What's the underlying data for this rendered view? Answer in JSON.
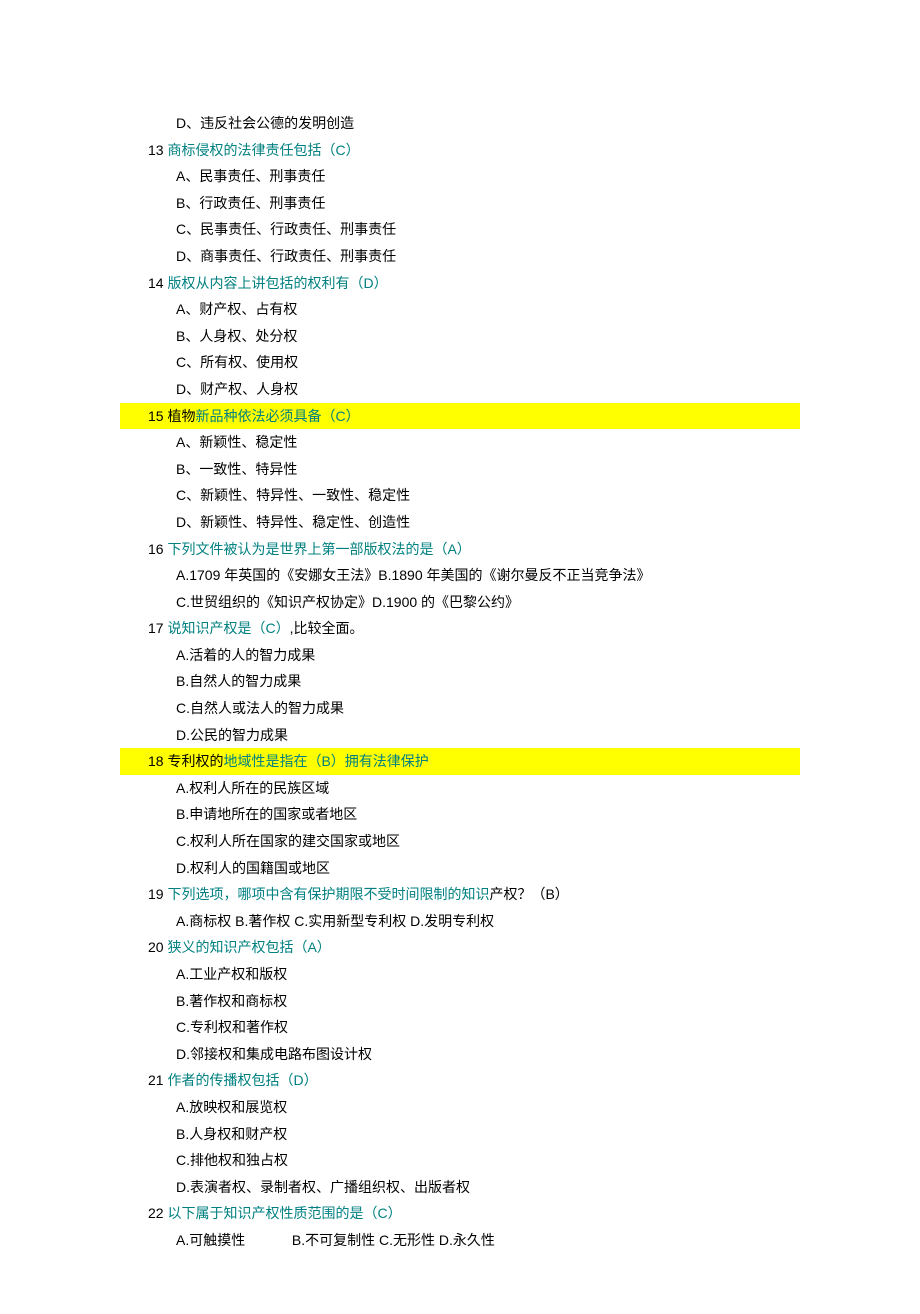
{
  "lines": [
    {
      "cls": "indent2",
      "segs": [
        {
          "t": "D、违反社会公德的发明创造"
        }
      ]
    },
    {
      "cls": "indent1",
      "segs": [
        {
          "t": "13 "
        },
        {
          "t": "商标侵权的法律责任包括（C）",
          "c": "teal"
        }
      ]
    },
    {
      "cls": "indent2",
      "segs": [
        {
          "t": "A、民事责任、刑事责任"
        }
      ]
    },
    {
      "cls": "indent2",
      "segs": [
        {
          "t": "B、行政责任、刑事责任"
        }
      ]
    },
    {
      "cls": "indent2",
      "segs": [
        {
          "t": "C、民事责任、行政责任、刑事责任"
        }
      ]
    },
    {
      "cls": "indent2",
      "segs": [
        {
          "t": "D、商事责任、行政责任、刑事责任"
        }
      ]
    },
    {
      "cls": "indent1",
      "segs": [
        {
          "t": "14 "
        },
        {
          "t": "版权从内容上讲包括的权利有（D）",
          "c": "teal"
        }
      ]
    },
    {
      "cls": "indent2",
      "segs": [
        {
          "t": "A、财产权、占有权"
        }
      ]
    },
    {
      "cls": "indent2",
      "segs": [
        {
          "t": "B、人身权、处分权"
        }
      ]
    },
    {
      "cls": "indent2",
      "segs": [
        {
          "t": "C、所有权、使用权"
        }
      ]
    },
    {
      "cls": "indent2",
      "segs": [
        {
          "t": "D、财产权、人身权"
        }
      ]
    },
    {
      "cls": "indent1 hl-line",
      "segs": [
        {
          "t": "15 植物"
        },
        {
          "t": "新品种依法必须具备（C）",
          "c": "teal"
        }
      ]
    },
    {
      "cls": "indent2",
      "segs": [
        {
          "t": "A、新颖性、稳定性"
        }
      ]
    },
    {
      "cls": "indent2",
      "segs": [
        {
          "t": "B、一致性、特异性"
        }
      ]
    },
    {
      "cls": "indent2",
      "segs": [
        {
          "t": "C、新颖性、特异性、一致性、稳定性"
        }
      ]
    },
    {
      "cls": "indent2",
      "segs": [
        {
          "t": "D、新颖性、特异性、稳定性、创造性"
        }
      ]
    },
    {
      "cls": "indent1",
      "segs": [
        {
          "t": "16 "
        },
        {
          "t": "下列文件被认为是世界上第一部版权法的是（A）",
          "c": "teal"
        }
      ]
    },
    {
      "cls": "indent2",
      "segs": [
        {
          "t": "A.1709 年英国的《安娜女王法》B.1890 年美国的《谢尔曼反不正当竞争法》"
        }
      ]
    },
    {
      "cls": "indent2",
      "segs": [
        {
          "t": "C.世贸组织的《知识产权协定》D.1900 的《巴黎公约》"
        }
      ]
    },
    {
      "cls": "indent1",
      "segs": [
        {
          "t": "17 "
        },
        {
          "t": "说知识产权是（C）",
          "c": "teal"
        },
        {
          "t": ",比较全面。"
        }
      ]
    },
    {
      "cls": "indent2",
      "segs": [
        {
          "t": "A.活着的人的智力成果"
        }
      ]
    },
    {
      "cls": "indent2",
      "segs": [
        {
          "t": "B.自然人的智力成果"
        }
      ]
    },
    {
      "cls": "indent2",
      "segs": [
        {
          "t": "C.自然人或法人的智力成果"
        }
      ]
    },
    {
      "cls": "indent2",
      "segs": [
        {
          "t": "D.公民的智力成果"
        }
      ]
    },
    {
      "cls": "indent1 hl-line",
      "segs": [
        {
          "t": "18 专利权的"
        },
        {
          "t": "地域性是指在（B）拥有法律保护",
          "c": "teal"
        }
      ]
    },
    {
      "cls": "indent2",
      "segs": [
        {
          "t": "A.权利人所在的民族区域"
        }
      ]
    },
    {
      "cls": "indent2",
      "segs": [
        {
          "t": "B.申请地所在的国家或者地区"
        }
      ]
    },
    {
      "cls": "indent2",
      "segs": [
        {
          "t": "C.权利人所在国家的建交国家或地区"
        }
      ]
    },
    {
      "cls": "indent2",
      "segs": [
        {
          "t": "D.权利人的国籍国或地区"
        }
      ]
    },
    {
      "cls": "indent1",
      "segs": [
        {
          "t": "19 "
        },
        {
          "t": "下列选项，哪项中含有保护期限不受时间限制的知识",
          "c": "teal"
        },
        {
          "t": "产权？（B）"
        }
      ]
    },
    {
      "cls": "indent2",
      "segs": [
        {
          "t": "A.商标权 B.著作权 C.实用新型专利权 D.发明专利权"
        }
      ]
    },
    {
      "cls": "indent1",
      "segs": [
        {
          "t": "20 "
        },
        {
          "t": "狭义的知识产权包括（A）",
          "c": "teal"
        }
      ]
    },
    {
      "cls": "indent2",
      "segs": [
        {
          "t": "A.工业产权和版权"
        }
      ]
    },
    {
      "cls": "indent2",
      "segs": [
        {
          "t": "B.著作权和商标权"
        }
      ]
    },
    {
      "cls": "indent2",
      "segs": [
        {
          "t": "C.专利权和著作权"
        }
      ]
    },
    {
      "cls": "indent2",
      "segs": [
        {
          "t": "D.邻接权和集成电路布图设计权"
        }
      ]
    },
    {
      "cls": "indent1",
      "segs": [
        {
          "t": "21 "
        },
        {
          "t": "作者的传播权包括（D）",
          "c": "teal"
        }
      ]
    },
    {
      "cls": "indent2",
      "segs": [
        {
          "t": "A.放映权和展览权"
        }
      ]
    },
    {
      "cls": "indent2",
      "segs": [
        {
          "t": "B.人身权和财产权"
        }
      ]
    },
    {
      "cls": "indent2",
      "segs": [
        {
          "t": "C.排他权和独占权"
        }
      ]
    },
    {
      "cls": "indent2",
      "segs": [
        {
          "t": "D.表演者权、录制者权、广播组织权、出版者权"
        }
      ]
    },
    {
      "cls": "indent1",
      "segs": [
        {
          "t": "22 "
        },
        {
          "t": "以下属于知识产权性质范围的是（C）",
          "c": "teal"
        }
      ]
    },
    {
      "cls": "indent2",
      "segs": [
        {
          "t": "A.可触摸性            B.不可复制性 C.无形性 D.永久性"
        }
      ]
    }
  ]
}
